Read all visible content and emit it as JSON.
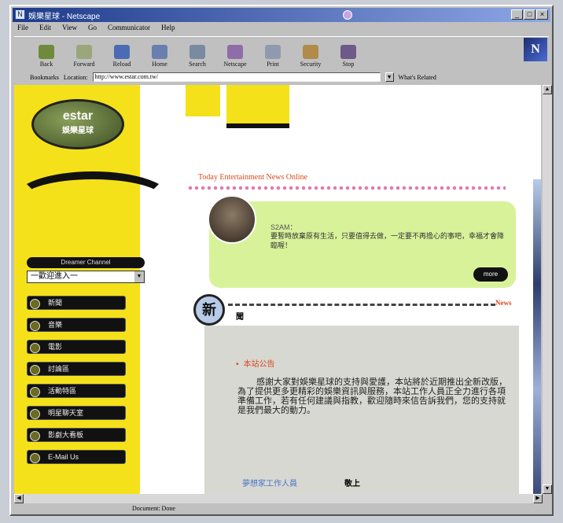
{
  "window": {
    "title": "娛樂星球 - Netscape",
    "buttons": [
      "_",
      "□",
      "×"
    ]
  },
  "menu": [
    "File",
    "Edit",
    "View",
    "Go",
    "Communicator",
    "Help"
  ],
  "toolbar": [
    "Back",
    "Forward",
    "Reload",
    "Home",
    "Search",
    "Netscape",
    "Print",
    "Security",
    "Stop"
  ],
  "location": {
    "bookmarks_label": "Bookmarks",
    "location_label": "Location:",
    "url": "http://www.estar.com.tw/",
    "related_label": "What's Related"
  },
  "status": "Document: Done",
  "site": {
    "logo_main": "estar",
    "logo_sub": "娛樂星球",
    "channel_label": "Dreamer Channel",
    "channel_select": "一歡迎進入一",
    "nav": [
      "新聞",
      "音樂",
      "電影",
      "討論區",
      "活動特區",
      "明星聊天室",
      "影劇大看板",
      "E-Mail Us"
    ],
    "heading": "Today Entertainment News Online",
    "bubble_name": "S2AM：",
    "bubble_text": "要暫時放棄原有生活，只要值得去做，一定要不再擔心的事吧，幸福才會降臨喔！",
    "more": "more",
    "news_badge": "新",
    "news_badge2": "聞",
    "news_label": "News",
    "notice_title": "本站公告",
    "notice_body": "感謝大家對娛樂星球的支持與愛護，本站將於近期推出全新改版，為了提供更多更精彩的娛樂資訊與服務，本站工作人員正全力進行各項準備工作，若有任何建議與指教，歡迎隨時來信告訴我們，您的支持就是我們最大的動力。",
    "notice_sig": "夢想家工作人員",
    "notice_sig2": "敬上"
  }
}
